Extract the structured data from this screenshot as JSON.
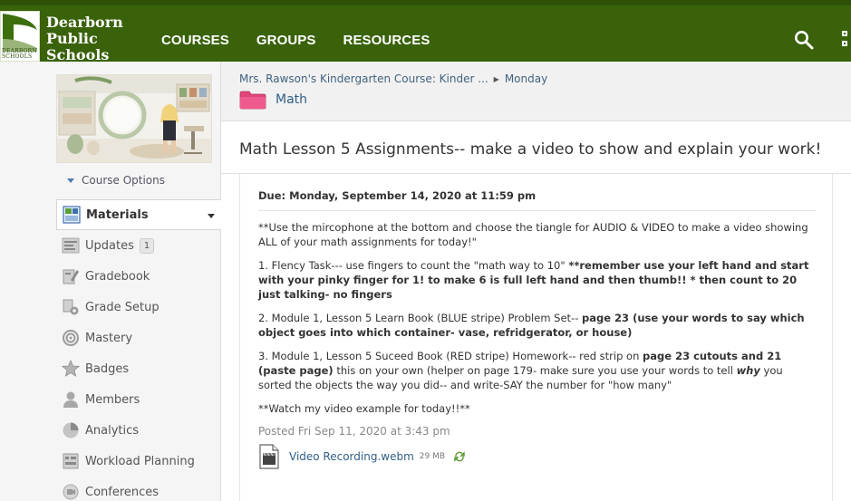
{
  "brand": {
    "line1": "Dearborn",
    "line2": "Public",
    "line3": "Schools",
    "logo_sub1": "DEARBORN",
    "logo_sub2": "SCHOOLS"
  },
  "nav": {
    "courses": "COURSES",
    "groups": "GROUPS",
    "resources": "RESOURCES"
  },
  "sidebar": {
    "course_options": "Course Options",
    "items": [
      {
        "label": "Materials",
        "icon": "materials-icon"
      },
      {
        "label": "Updates",
        "icon": "updates-icon",
        "badge": "1"
      },
      {
        "label": "Gradebook",
        "icon": "gradebook-icon"
      },
      {
        "label": "Grade Setup",
        "icon": "grade-setup-icon"
      },
      {
        "label": "Mastery",
        "icon": "mastery-icon"
      },
      {
        "label": "Badges",
        "icon": "badges-icon"
      },
      {
        "label": "Members",
        "icon": "members-icon"
      },
      {
        "label": "Analytics",
        "icon": "analytics-icon"
      },
      {
        "label": "Workload Planning",
        "icon": "workload-icon"
      },
      {
        "label": "Conferences",
        "icon": "conferences-icon"
      }
    ]
  },
  "main": {
    "breadcrumb_course": "Mrs. Rawson's Kindergarten Course: Kinder ...",
    "breadcrumb_sep": "▶",
    "breadcrumb_page": "Monday",
    "folder": "Math",
    "title": "Math Lesson 5 Assignments-- make a video to show and explain your work!",
    "due": "Due: Monday, September 14, 2020 at 11:59 pm",
    "p1": "**Use the mircophone at the bottom and choose the tiangle  for AUDIO & VIDEO to make a video showing ALL of your math assignments for today!\"",
    "p2a": "1.  Flency Task--- use fingers to count the \"math way to 10\"  ",
    "p2b": "**remember use your left hand and start with your pinky finger for 1! to make 6 is full left hand and then thumb!!    * then count to 20 just talking- no fingers",
    "p3a": "2.  Module 1, Lesson 5 Learn Book (BLUE stripe) Problem Set-- ",
    "p3b": "page 23 (use your words to say which object goes into which container- vase, refridgerator, or house)",
    "p4a": "3. Module 1, Lesson 5 Suceed Book (RED stripe) Homework-- red strip on ",
    "p4b": "page 23 cutouts and 21 (paste page)",
    "p4c": "  this on your own (helper on page 179- make sure you use your words to tell ",
    "p4d": "why",
    "p4e": " you sorted the objects the way you did-- and write-SAY the number for \"how many\"",
    "p5": "**Watch my video example for today!!**",
    "posted": "Posted Fri Sep 11, 2020 at 3:43 pm",
    "file_name": "Video Recording.webm",
    "file_size": "29 MB"
  },
  "colors": {
    "topbar": "#39620a",
    "link": "#2f5f86",
    "folder": "#e0457b"
  }
}
